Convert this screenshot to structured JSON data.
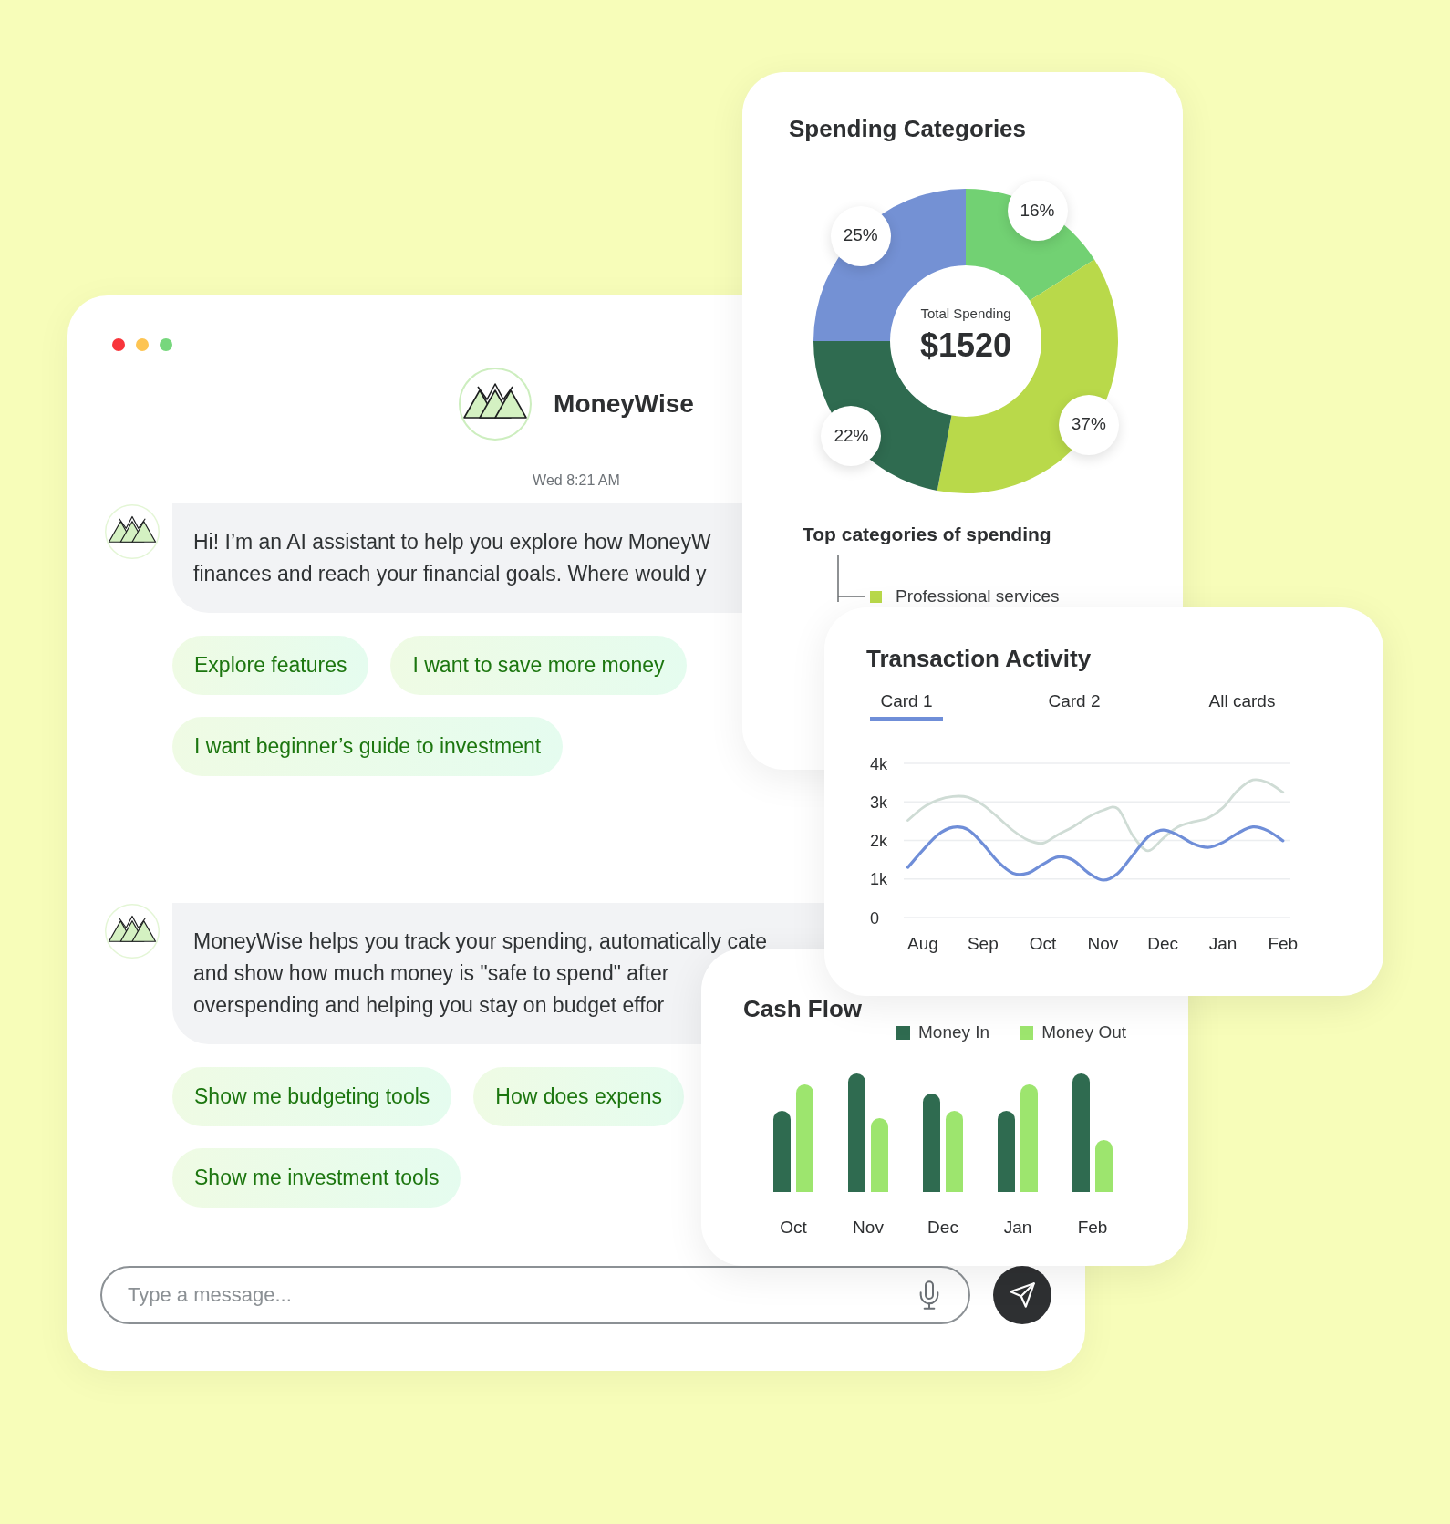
{
  "chat": {
    "window_controls": [
      {
        "color": "#f8353b"
      },
      {
        "color": "#fdc452"
      },
      {
        "color": "#77d77d"
      }
    ],
    "title": "MoneyWise",
    "timestamp": "Wed 8:21 AM",
    "messages": [
      {
        "lines": [
          "Hi! I’m an AI assistant to help you explore how MoneyW",
          "finances and reach your financial goals. Where would y"
        ],
        "suggestion_rows": [
          [
            "Explore features",
            "I want to save more money"
          ],
          [
            "I want beginner’s guide to investment"
          ]
        ]
      },
      {
        "lines": [
          "MoneyWise helps you track your spending, automatically cate",
          "and show how much money is \"safe to spend\" after",
          "overspending and helping you stay on budget effor"
        ],
        "suggestion_rows": [
          [
            "Show me budgeting tools",
            "How does expens"
          ],
          [
            "Show me investment tools"
          ]
        ]
      }
    ],
    "input": {
      "placeholder": "Type a message..."
    }
  },
  "spending_categories": {
    "title": "Spending Categories",
    "chart_data": {
      "type": "donut",
      "values": [
        16,
        37,
        22,
        25
      ],
      "colors": [
        "#72d173",
        "#b9d94a",
        "#2f6b50",
        "#7491d4"
      ],
      "value_labels": [
        "16%",
        "37%",
        "22%",
        "25%"
      ]
    },
    "center_label": "Total Spending",
    "total": "$1520",
    "subtitle": "Top categories of spending",
    "legend": [
      {
        "label": "Professional services",
        "color": "#b9d94a"
      }
    ]
  },
  "transaction_activity": {
    "title": "Transaction Activity",
    "tabs": [
      {
        "label": "Card 1",
        "selected": true
      },
      {
        "label": "Card 2",
        "selected": false
      },
      {
        "label": "All cards",
        "selected": false
      }
    ],
    "chart_data": {
      "type": "line",
      "grid": true,
      "categories": [
        null,
        "Aug",
        null,
        null,
        null,
        "Sep",
        null,
        null,
        null,
        "Oct",
        null,
        null,
        null,
        "Nov",
        null,
        null,
        null,
        "Dec",
        null,
        null,
        null,
        "Jan",
        null,
        null,
        null,
        "Feb"
      ],
      "ylim": [
        0,
        4000
      ],
      "yticks": [
        {
          "value": 4000,
          "label": "4k"
        },
        {
          "value": 3000,
          "label": "3k"
        },
        {
          "value": 2000,
          "label": "2k"
        },
        {
          "value": 1000,
          "label": "1k"
        },
        {
          "value": 0,
          "label": "0"
        }
      ],
      "series": [
        {
          "color": "#6f8ed8",
          "values": [
            1300,
            1750,
            2150,
            2340,
            2280,
            1910,
            1450,
            1150,
            1150,
            1380,
            1570,
            1490,
            1170,
            970,
            1150,
            1620,
            2090,
            2270,
            2140,
            1920,
            1820,
            1950,
            2190,
            2350,
            2250,
            1990
          ]
        },
        {
          "color": "#cfdcd5",
          "values": [
            2520,
            2850,
            3050,
            3140,
            3120,
            2920,
            2600,
            2260,
            2010,
            1930,
            2150,
            2350,
            2600,
            2780,
            2820,
            2120,
            1730,
            2050,
            2350,
            2480,
            2580,
            2850,
            3300,
            3570,
            3500,
            3250
          ]
        }
      ]
    }
  },
  "cash_flow": {
    "title": "Cash Flow",
    "legend": [
      {
        "label": "Money In",
        "color": "#2f6b50"
      },
      {
        "label": "Money Out",
        "color": "#9de56e"
      }
    ],
    "months": [
      "Oct",
      "Nov",
      "Dec",
      "Jan",
      "Feb"
    ]
  }
}
